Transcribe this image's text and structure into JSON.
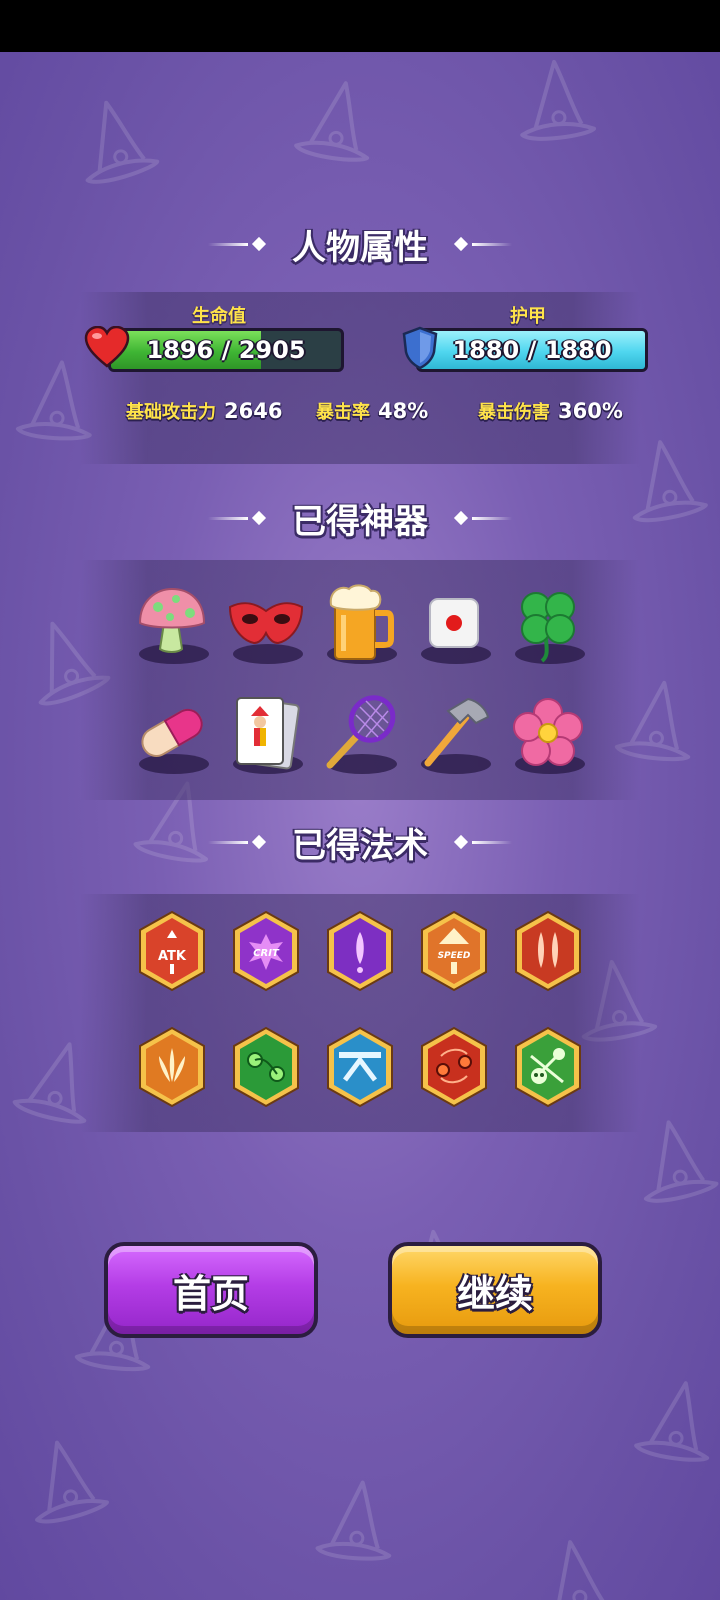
{
  "sections": {
    "attributes_title": "人物属性",
    "artifacts_title": "已得神器",
    "spells_title": "已得法术"
  },
  "hp": {
    "label": "生命值",
    "current": 1896,
    "max": 2905,
    "display": "1896 / 2905",
    "color": "#45c13a"
  },
  "armor": {
    "label": "护甲",
    "current": 1880,
    "max": 1880,
    "display": "1880 / 1880",
    "color": "#4fd6ef"
  },
  "stats": [
    {
      "label": "基础攻击力",
      "value": "2646"
    },
    {
      "label": "暴击率",
      "value": "48%"
    },
    {
      "label": "暴击伤害",
      "value": "360%"
    }
  ],
  "artifacts": [
    {
      "icon": "mushroom-icon"
    },
    {
      "icon": "mask-icon"
    },
    {
      "icon": "beer-mug-icon"
    },
    {
      "icon": "dice-icon"
    },
    {
      "icon": "four-leaf-clover-icon"
    },
    {
      "icon": "pill-capsule-icon"
    },
    {
      "icon": "joker-card-icon"
    },
    {
      "icon": "tennis-racket-icon"
    },
    {
      "icon": "hammer-icon"
    },
    {
      "icon": "pink-flower-icon"
    }
  ],
  "spells": [
    {
      "icon": "attack-up-badge-icon",
      "text": "ATK"
    },
    {
      "icon": "crit-badge-icon",
      "text": "CRIT"
    },
    {
      "icon": "arrow-shot-badge-icon"
    },
    {
      "icon": "speed-up-badge-icon",
      "text": "SPEED"
    },
    {
      "icon": "double-arrow-badge-icon"
    },
    {
      "icon": "spread-shot-badge-icon"
    },
    {
      "icon": "poison-orbs-badge-icon"
    },
    {
      "icon": "bounce-arrow-badge-icon"
    },
    {
      "icon": "fire-orbs-badge-icon"
    },
    {
      "icon": "skull-chain-badge-icon"
    }
  ],
  "buttons": {
    "home_label": "首页",
    "continue_label": "继续"
  },
  "colors": {
    "background": "#7a5fb3",
    "home_button": "#b43de6",
    "continue_button": "#f7b320",
    "stat_label": "#ffe34a"
  }
}
